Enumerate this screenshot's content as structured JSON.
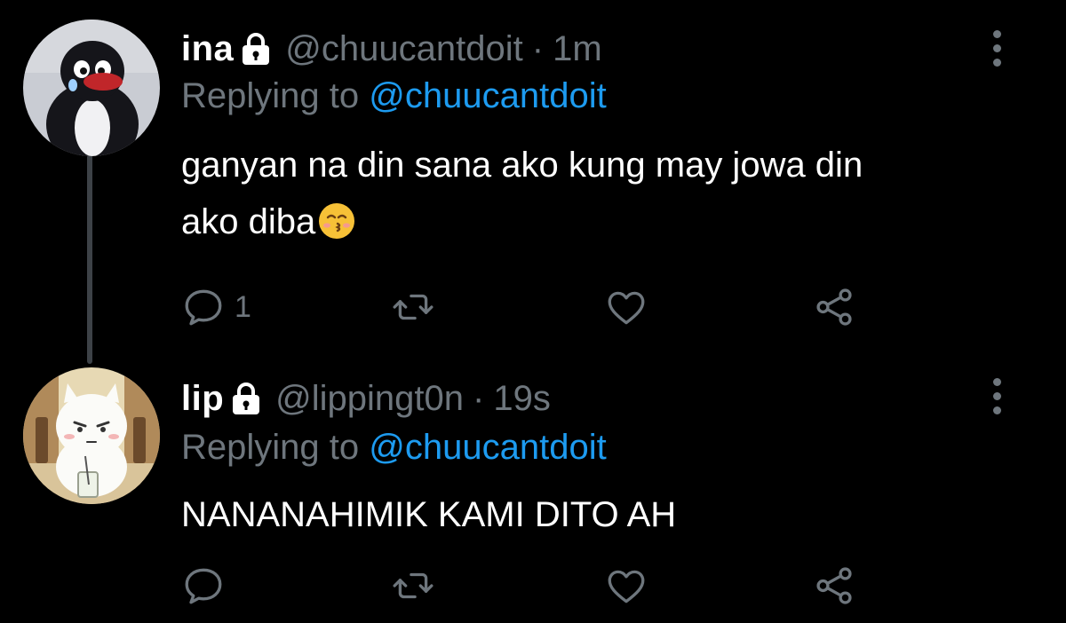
{
  "colors": {
    "background": "#000000",
    "text_primary": "#ffffff",
    "text_secondary": "#6e767d",
    "link": "#1d9bf0",
    "thread_line": "#3d4247"
  },
  "tweets": [
    {
      "display_name": "ina",
      "protected_icon": "lock-icon",
      "handle": "@chuucantdoit",
      "separator": "·",
      "time": "1m",
      "reply_prefix": "Replying to",
      "reply_to": "@chuucantdoit",
      "text_line1": "ganyan na din sana ako kung may jowa din",
      "text_line2": "ako diba",
      "emoji": "kissing-face-with-closed-eyes-emoji",
      "reply_count": "1",
      "avatar": "penguin-avatar"
    },
    {
      "display_name": "lip",
      "protected_icon": "lock-icon",
      "handle": "@lippingt0n",
      "separator": "·",
      "time": "19s",
      "reply_prefix": "Replying to",
      "reply_to": "@chuucantdoit",
      "text_line1": "NANANAHIMIK KAMI DITO AH",
      "reply_count": "",
      "avatar": "cartoon-cat-avatar"
    }
  ],
  "action_icons": [
    "reply-icon",
    "retweet-icon",
    "like-icon",
    "share-icon"
  ]
}
